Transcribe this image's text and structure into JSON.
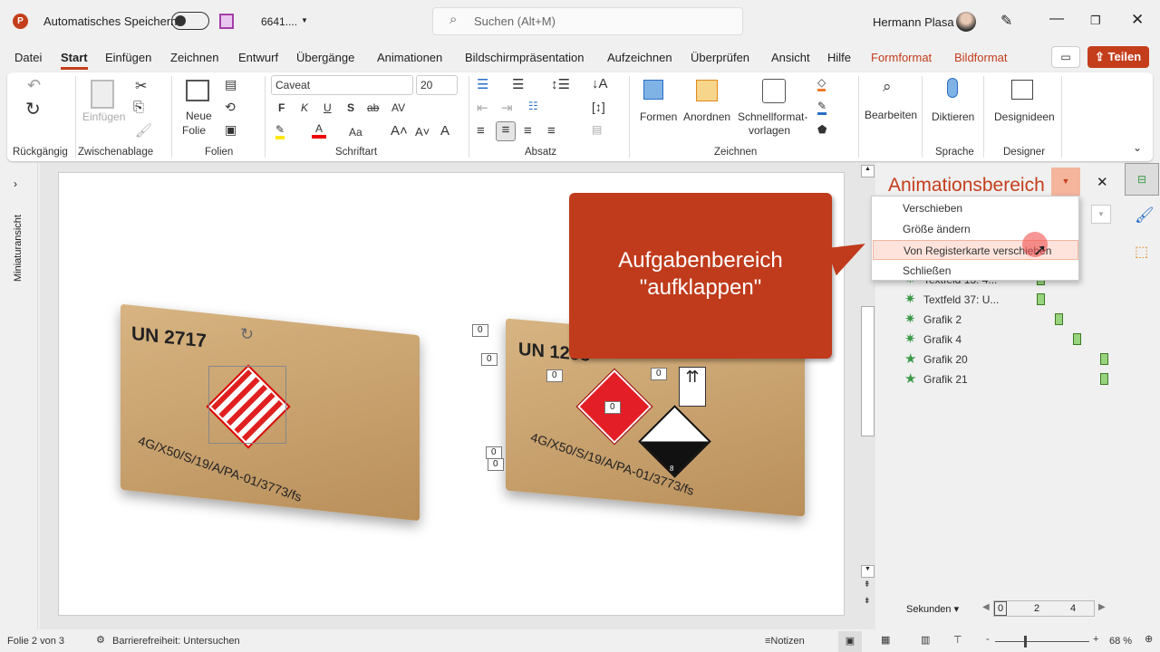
{
  "titlebar": {
    "autosave_label": "Automatisches Speichern",
    "filename": "6641....",
    "search_placeholder": "Suchen (Alt+M)",
    "user": "Hermann Plasa"
  },
  "tabs": [
    "Datei",
    "Start",
    "Einfügen",
    "Zeichnen",
    "Entwurf",
    "Übergänge",
    "Animationen",
    "Bildschirmpräsentation",
    "Aufzeichnen",
    "Überprüfen",
    "Ansicht",
    "Hilfe",
    "Formformat",
    "Bildformat"
  ],
  "active_tab": "Start",
  "share_label": "Teilen",
  "ribbon": {
    "groups": [
      "Rückgängig",
      "Zwischenablage",
      "Folien",
      "Schriftart",
      "Absatz",
      "Zeichnen",
      "Sprache",
      "Designer"
    ],
    "paste": "Einfügen",
    "new_slide_1": "Neue",
    "new_slide_2": "Folie",
    "font": "Caveat",
    "font_size": "20",
    "bold": "F",
    "italic": "K",
    "underline": "U",
    "shadow": "S",
    "strike": "ab",
    "spacing": "AV",
    "case": "Aa",
    "shapes": "Formen",
    "arrange": "Anordnen",
    "quick_styles_1": "Schnellformat-",
    "quick_styles_2": "vorlagen",
    "edit": "Bearbeiten",
    "dictate": "Diktieren",
    "design_ideas": "Designideen"
  },
  "left_strip_label": "Miniaturansicht",
  "slide": {
    "box1_code": "UN 2717",
    "box1_marking": "4G/X50/S/19/A/PA-01/3773/fs",
    "box2_code": "UN 1298",
    "box2_marking": "4G/X50/S/19/A/PA-01/3773/fs",
    "tags": [
      "0",
      "0",
      "0",
      "0",
      "0",
      "0",
      "0"
    ],
    "class_label": "8"
  },
  "callout": {
    "line1": "Aufgabenbereich",
    "line2": "\"aufklappen\"",
    "color": "#c03b1c"
  },
  "pane": {
    "title": "Animationsbereich",
    "menu": [
      "Verschieben",
      "Größe ändern",
      "Von Registerkarte verschieben",
      "Schließen"
    ],
    "items": [
      {
        "label": "Textfeld 13: 4..."
      },
      {
        "label": "Textfeld 37: U..."
      },
      {
        "label": "Grafik 2"
      },
      {
        "label": "Grafik 4"
      },
      {
        "label": "Grafik 20"
      },
      {
        "label": "Grafik 21"
      }
    ],
    "seconds_label": "Sekunden",
    "timeline": [
      "0",
      "2",
      "4"
    ]
  },
  "status": {
    "slide": "Folie 2 von 3",
    "accessibility": "Barrierefreiheit: Untersuchen",
    "notes": "Notizen",
    "zoom": "68 %"
  }
}
